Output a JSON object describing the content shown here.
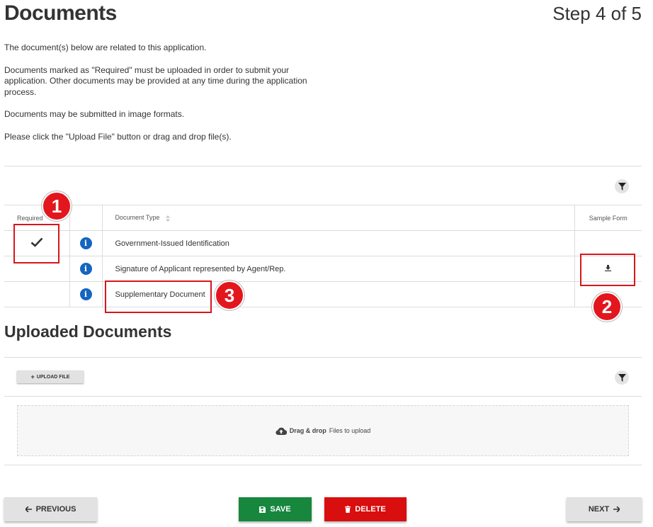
{
  "header": {
    "title": "Documents",
    "step": "Step 4 of 5"
  },
  "intro": {
    "p1": "The document(s) below are related to this application.",
    "p2": "Documents marked as \"Required\" must be uploaded in order to submit your application. Other documents may be provided at any time during the application process.",
    "p3": "Documents may be submitted in image formats.",
    "p4": "Please click the \"Upload File\" button or drag and drop file(s)."
  },
  "table": {
    "headers": {
      "required": "Required",
      "type": "Document Type",
      "sample": "Sample Form"
    },
    "rows": [
      {
        "required": true,
        "type": "Government-Issued Identification",
        "has_sample": false
      },
      {
        "required": false,
        "type": "Signature of Applicant represented by Agent/Rep.",
        "has_sample": true
      },
      {
        "required": false,
        "type": "Supplementary Document",
        "has_sample": false
      }
    ]
  },
  "annotations": [
    "1",
    "2",
    "3"
  ],
  "uploaded": {
    "title": "Uploaded Documents",
    "upload_label": "UPLOAD FILE",
    "drop_bold": "Drag & drop",
    "drop_rest": "Files to upload"
  },
  "footer": {
    "previous": "PREVIOUS",
    "save": "SAVE",
    "delete": "DELETE",
    "next": "NEXT"
  },
  "colors": {
    "save": "#17873d",
    "delete": "#d90e0e",
    "info": "#1565c0",
    "annotation": "#e3161e"
  },
  "icons": [
    "check-icon",
    "info-icon",
    "download-icon",
    "filter-icon",
    "sort-icon",
    "plus-icon",
    "cloud-upload-icon",
    "save-icon",
    "trash-icon",
    "arrow-left-icon",
    "arrow-right-icon"
  ]
}
